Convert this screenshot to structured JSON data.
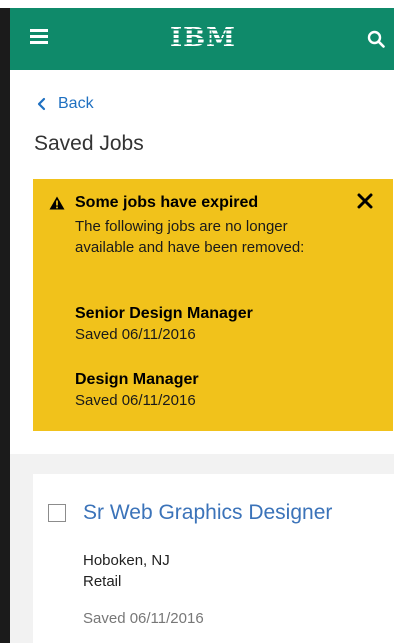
{
  "header": {
    "logo_text": "IBM",
    "menu_icon": "hamburger-menu-icon",
    "search_icon": "search-icon",
    "bg_color": "#0f8a6a"
  },
  "nav": {
    "back_label": "Back"
  },
  "page": {
    "title": "Saved Jobs"
  },
  "alert": {
    "title": "Some jobs have expired",
    "body": "The following jobs are no longer available and have been removed:",
    "bg_color": "#f1c21b",
    "expired_jobs": [
      {
        "name": "Senior Design Manager",
        "saved": "Saved 06/11/2016"
      },
      {
        "name": "Design Manager",
        "saved": "Saved 06/11/2016"
      }
    ]
  },
  "saved_jobs": [
    {
      "title": "Sr Web Graphics Designer",
      "location": "Hoboken, NJ",
      "industry": "Retail",
      "saved": "Saved 06/11/2016"
    }
  ]
}
